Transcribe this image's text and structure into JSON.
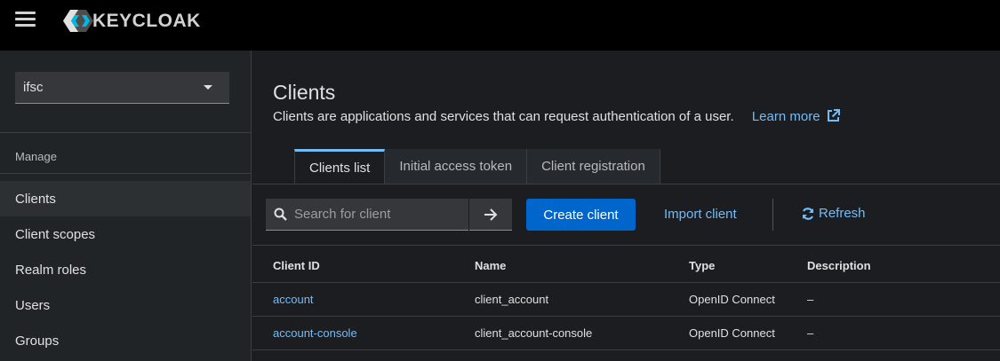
{
  "header": {
    "brand": "KEYCLOAK"
  },
  "sidebar": {
    "realm": "ifsc",
    "section": "Manage",
    "items": [
      {
        "label": "Clients",
        "active": true
      },
      {
        "label": "Client scopes"
      },
      {
        "label": "Realm roles"
      },
      {
        "label": "Users"
      },
      {
        "label": "Groups"
      }
    ]
  },
  "page": {
    "title": "Clients",
    "description": "Clients are applications and services that can request authentication of a user.",
    "learn_more": "Learn more"
  },
  "tabs": [
    {
      "label": "Clients list",
      "active": true
    },
    {
      "label": "Initial access token"
    },
    {
      "label": "Client registration"
    }
  ],
  "toolbar": {
    "search_placeholder": "Search for client",
    "create_label": "Create client",
    "import_label": "Import client",
    "refresh_label": "Refresh"
  },
  "table": {
    "columns": [
      "Client ID",
      "Name",
      "Type",
      "Description"
    ],
    "rows": [
      {
        "client_id": "account",
        "name": "client_account",
        "type": "OpenID Connect",
        "description": "–"
      },
      {
        "client_id": "account-console",
        "name": "client_account-console",
        "type": "OpenID Connect",
        "description": "–"
      }
    ]
  },
  "colors": {
    "accent": "#73bcf7",
    "primary_button": "#0066cc",
    "masthead": "#000000"
  }
}
